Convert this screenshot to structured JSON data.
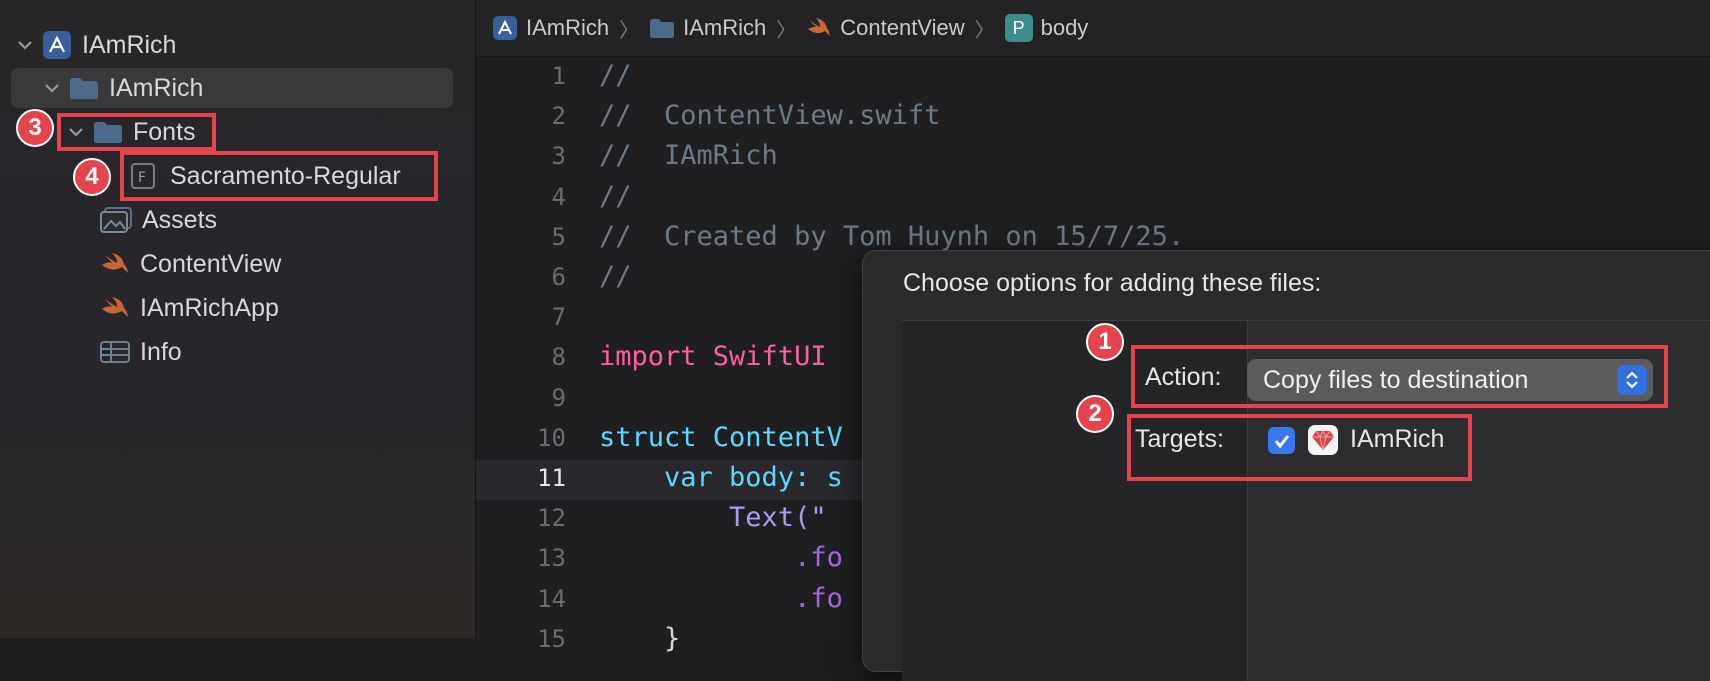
{
  "sidebar": {
    "project": "IAmRich",
    "group": "IAmRich",
    "fonts_folder": "Fonts",
    "font_file": "Sacramento-Regular",
    "items": [
      "Assets",
      "ContentView",
      "IAmRichApp",
      "Info"
    ]
  },
  "breadcrumb": {
    "items": [
      "IAmRich",
      "IAmRich",
      "ContentView",
      "body"
    ],
    "body_letter": "P"
  },
  "editor": {
    "line_numbers": [
      "1",
      "2",
      "3",
      "4",
      "5",
      "6",
      "7",
      "8",
      "9",
      "10",
      "11",
      "12",
      "13",
      "14",
      "15"
    ],
    "current_line": "11",
    "lines": [
      "//",
      "//  ContentView.swift",
      "//  IAmRich",
      "//",
      "//  Created by Tom Huynh on 15/7/25.",
      "//",
      "",
      "import SwiftUI",
      "",
      "struct ContentV",
      "    var body: s",
      "        Text(\"",
      "            .fo",
      "            .fo",
      "    }"
    ]
  },
  "dialog": {
    "title": "Choose options for adding these files:",
    "action_label": "Action:",
    "action_value": "Copy files to destination",
    "targets_label": "Targets:",
    "target_name": "IAmRich",
    "target_checked": true
  },
  "annotations": {
    "badge_1": "1",
    "badge_2": "2",
    "badge_3": "3",
    "badge_4": "4"
  },
  "colors": {
    "highlight": "#e5434d",
    "keyword": "#fc5fa3",
    "type": "#5dd8ff",
    "comment": "#6c7986",
    "accent": "#3a78f2"
  },
  "icons": {
    "project": "xcode-project-icon",
    "folder": "folder-icon",
    "font_file": "font-file-icon",
    "assets": "asset-catalog-icon",
    "swift": "swift-file-icon",
    "plist": "plist-table-icon"
  }
}
